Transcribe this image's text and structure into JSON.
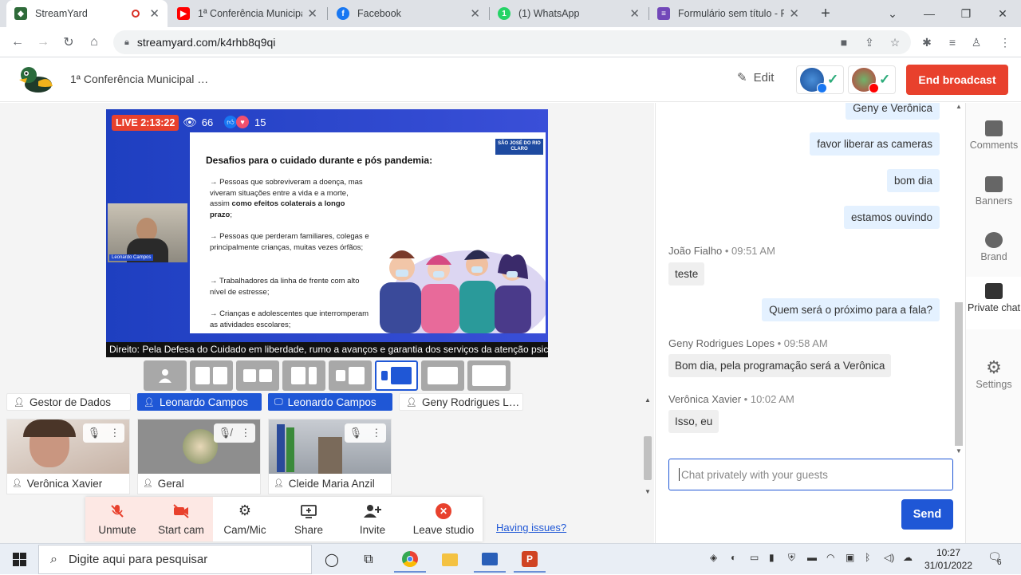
{
  "browser": {
    "tabs": [
      {
        "title": "StreamYard",
        "icon": "streamyard-duck-icon"
      },
      {
        "title": "1ª Conferência Municipal",
        "icon": "youtube-icon"
      },
      {
        "title": "Facebook",
        "icon": "facebook-icon"
      },
      {
        "title": "(1) WhatsApp",
        "icon": "whatsapp-icon"
      },
      {
        "title": "Formulário sem título - Fo",
        "icon": "google-forms-icon"
      }
    ],
    "url": "streamyard.com/k4rhb8q9qi"
  },
  "header": {
    "broadcast_title": "1ª Conferência Municipal …",
    "edit_label": "Edit",
    "end_label": "End broadcast"
  },
  "stage": {
    "live_label": "LIVE 2:13:22",
    "viewers": "66",
    "reactions": "15",
    "slide": {
      "logo_text": "SÃO JOSÉ DO RIO CLARO",
      "title": "Desafios para o cuidado durante e pós pandemia:",
      "bullets": [
        {
          "pre": "→ Pessoas que sobreviveram a doença, mas viveram situações entre a vida e a morte, assim ",
          "bold": "como efeitos colaterais a longo prazo",
          "post": ";"
        },
        {
          "pre": "→ Pessoas que perderam familiares, colegas e principalmente crianças, muitas vezes órfãos;",
          "bold": "",
          "post": ""
        },
        {
          "pre": "→ Trabalhadores da linha de frente com alto nível de estresse;",
          "bold": "",
          "post": ""
        },
        {
          "pre": "→ Crianças e adolescentes que interromperam as atividades escolares;",
          "bold": "",
          "post": ""
        }
      ]
    },
    "cam_name": "Leonardo Campos",
    "ticker": "Direito: Pela Defesa do Cuidado em liberdade, rumo a avanços e garantia dos serviços da atenção psic"
  },
  "participants": {
    "chips": [
      {
        "name": "Gestor de Dados",
        "style": "plain",
        "icon": "person-icon"
      },
      {
        "name": "Leonardo Campos",
        "style": "blue",
        "icon": "person-icon"
      },
      {
        "name": "Leonardo Campos",
        "style": "blue",
        "icon": "screen-share-icon"
      },
      {
        "name": "Geny Rodrigues L…",
        "style": "plain",
        "icon": "person-icon"
      }
    ],
    "tiles": [
      {
        "name": "Verônica Xavier",
        "mic": "mic-icon"
      },
      {
        "name": "Geral",
        "mic": "mic-off-icon"
      },
      {
        "name": "Cleide Maria Anzil",
        "mic": "mic-icon"
      }
    ]
  },
  "controls": {
    "unmute": "Unmute",
    "start_cam": "Start cam",
    "cam_mic": "Cam/Mic",
    "share": "Share",
    "invite": "Invite",
    "leave": "Leave studio",
    "issues": "Having issues?"
  },
  "chat": {
    "messages_out": [
      "Geny e Verônica",
      "favor liberar as cameras",
      "bom dia",
      "estamos ouvindo"
    ],
    "m1": {
      "author": "João Fialho",
      "time": "09:51 AM",
      "text": "teste"
    },
    "out5": "Quem será o próximo para a fala?",
    "m2": {
      "author": "Geny Rodrigues Lopes",
      "time": "09:58 AM",
      "text": "Bom dia, pela programação será a Verônica"
    },
    "m3": {
      "author": "Verônica Xavier",
      "time": "10:02 AM",
      "text": "Isso, eu"
    },
    "placeholder": "Chat privately with your guests",
    "send": "Send"
  },
  "sidenav": {
    "comments": "Comments",
    "banners": "Banners",
    "brand": "Brand",
    "private_chat": "Private chat",
    "settings": "Settings"
  },
  "taskbar": {
    "search_placeholder": "Digite aqui para pesquisar",
    "time": "10:27",
    "date": "31/01/2022",
    "notifications": "6"
  },
  "colors": {
    "accent": "#1f57d6",
    "end_broadcast": "#e8412d",
    "live": "#e8412d"
  }
}
